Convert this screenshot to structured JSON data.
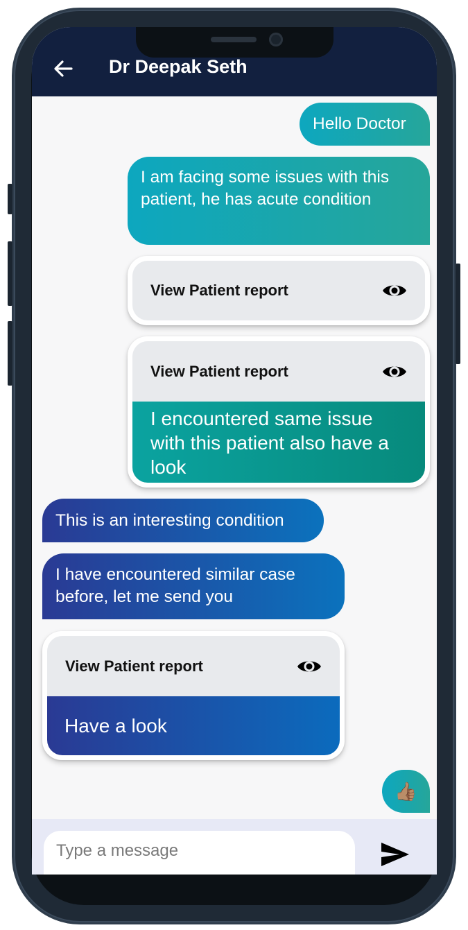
{
  "header": {
    "title": "Dr Deepak Seth",
    "background": "#12203f"
  },
  "messages": {
    "m1": "Hello Doctor",
    "m2": "I am facing some issues with this patient, he has acute condition",
    "m5": "This is an interesting condition",
    "m6": "I have encountered similar case before, let me send you",
    "m8": "👍🏽"
  },
  "reports": [
    {
      "label": "View Patient report",
      "caption": ""
    },
    {
      "label": "View Patient report",
      "caption": "I encountered same issue with this patient also have a look"
    },
    {
      "label": "View Patient report",
      "caption": "Have a look"
    }
  ],
  "composer": {
    "placeholder": "Type a message"
  },
  "colors": {
    "sent_start": "#0da7bf",
    "sent_end": "#26a69a",
    "received_start": "#2a3a94",
    "received_end": "#0b72bd",
    "input_bar": "#e7e9f6"
  }
}
